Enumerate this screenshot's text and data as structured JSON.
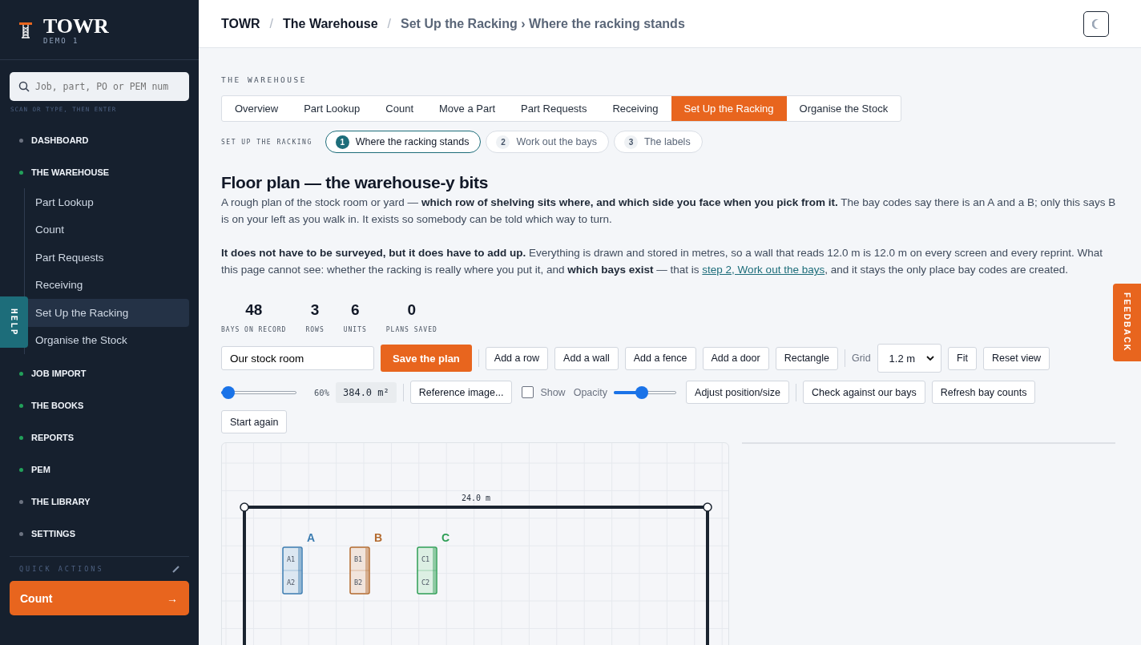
{
  "sidebar": {
    "brand": "TOWR",
    "env": "DEMO 1",
    "search": {
      "placeholder": "Job, part, PO or PEM num"
    },
    "search_hint": "SCAN OR TYPE, THEN ENTER",
    "nav": [
      {
        "label": "DASHBOARD",
        "color": "#6b7280"
      },
      {
        "label": "THE WAREHOUSE",
        "color": "#22a05a",
        "children": [
          {
            "label": "Part Lookup",
            "selected": false
          },
          {
            "label": "Count",
            "selected": false
          },
          {
            "label": "Part Requests",
            "selected": false
          },
          {
            "label": "Receiving",
            "selected": false
          },
          {
            "label": "Set Up the Racking",
            "selected": true
          },
          {
            "label": "Organise the Stock",
            "selected": false
          }
        ]
      },
      {
        "label": "JOB IMPORT",
        "color": "#22a05a"
      },
      {
        "label": "THE BOOKS",
        "color": "#22a05a"
      },
      {
        "label": "REPORTS",
        "color": "#22a05a"
      },
      {
        "label": "PEM",
        "color": "#22a05a"
      },
      {
        "label": "THE LIBRARY",
        "color": "#6b7280"
      },
      {
        "label": "SETTINGS",
        "color": "#6b7280"
      }
    ],
    "quick_actions": {
      "label": "QUICK ACTIONS",
      "button": "Count",
      "arrow": "→"
    }
  },
  "help_tab": "HELP",
  "feedback_tab": "FEEDBACK",
  "breadcrumbs": [
    "TOWR",
    "The Warehouse",
    "Set Up the Racking › Where the racking stands"
  ],
  "breadcrumb_separator": "/",
  "section_label": "THE WAREHOUSE",
  "tabs": [
    {
      "label": "Overview",
      "selected": false
    },
    {
      "label": "Part Lookup",
      "selected": false
    },
    {
      "label": "Count",
      "selected": false
    },
    {
      "label": "Move a Part",
      "selected": false
    },
    {
      "label": "Part Requests",
      "selected": false
    },
    {
      "label": "Receiving",
      "selected": false
    },
    {
      "label": "Set Up the Racking",
      "selected": true
    },
    {
      "label": "Organise the Stock",
      "selected": false
    }
  ],
  "steps_label": "SET UP THE RACKING",
  "steps": [
    {
      "number": "1",
      "label": "Where the racking stands",
      "selected": true
    },
    {
      "number": "2",
      "label": "Work out the bays",
      "selected": false
    },
    {
      "number": "3",
      "label": "The labels",
      "selected": false
    }
  ],
  "heading": "Floor plan — the warehouse-y bits",
  "intro": "A rough plan of the stock room or yard — **which row of shelving sits where, and which side you face when you pick from it.** The bay codes say there is an A and a B; only this says B is on your left as you walk in. It exists so somebody can be told which way to turn.",
  "note": {
    "before": "**It does not have to be surveyed, but it does have to add up.** Everything is drawn and stored in metres, so a wall that reads 12.0 m is 12.0 m on every screen and every reprint. What this page cannot see: whether the racking is really where you put it, and **which bays exist** — that is ",
    "link": "step 2, Work out the bays",
    "after": ", and it stays the only place bay codes are created."
  },
  "stats": [
    {
      "value": "48",
      "label": "BAYS ON RECORD"
    },
    {
      "value": "3",
      "label": "ROWS"
    },
    {
      "value": "6",
      "label": "UNITS"
    },
    {
      "value": "0",
      "label": "PLANS SAVED"
    }
  ],
  "toolbar": {
    "plan_name": "Our stock room",
    "save": "Save the plan",
    "tools": [
      "Add a row",
      "Add a wall",
      "Add a fence",
      "Add a door",
      "Rectangle"
    ],
    "grid_label": "Grid",
    "grid_value": "1.2 m",
    "view_buttons": [
      "Fit",
      "Reset view"
    ],
    "zoom": {
      "level": 0.1,
      "reading": "60%"
    },
    "area": "384.0 m²",
    "reference": "Reference image...",
    "show": {
      "label": "Show",
      "checked": false
    },
    "opacity": {
      "label": "Opacity",
      "level": 0.45
    },
    "buttons": [
      "Adjust position/size",
      "Check against our bays",
      "Refresh bay counts"
    ],
    "start_again": "Start again"
  },
  "plan": {
    "wall_length": "24.0 m",
    "rows": [
      {
        "label": "A",
        "color": "#3a7bb0",
        "bays": [
          "A1",
          "A2"
        ]
      },
      {
        "label": "B",
        "color": "#b36a2e",
        "bays": [
          "B1",
          "B2"
        ]
      },
      {
        "label": "C",
        "color": "#2e9e55",
        "bays": [
          "C1",
          "C2"
        ]
      }
    ]
  }
}
